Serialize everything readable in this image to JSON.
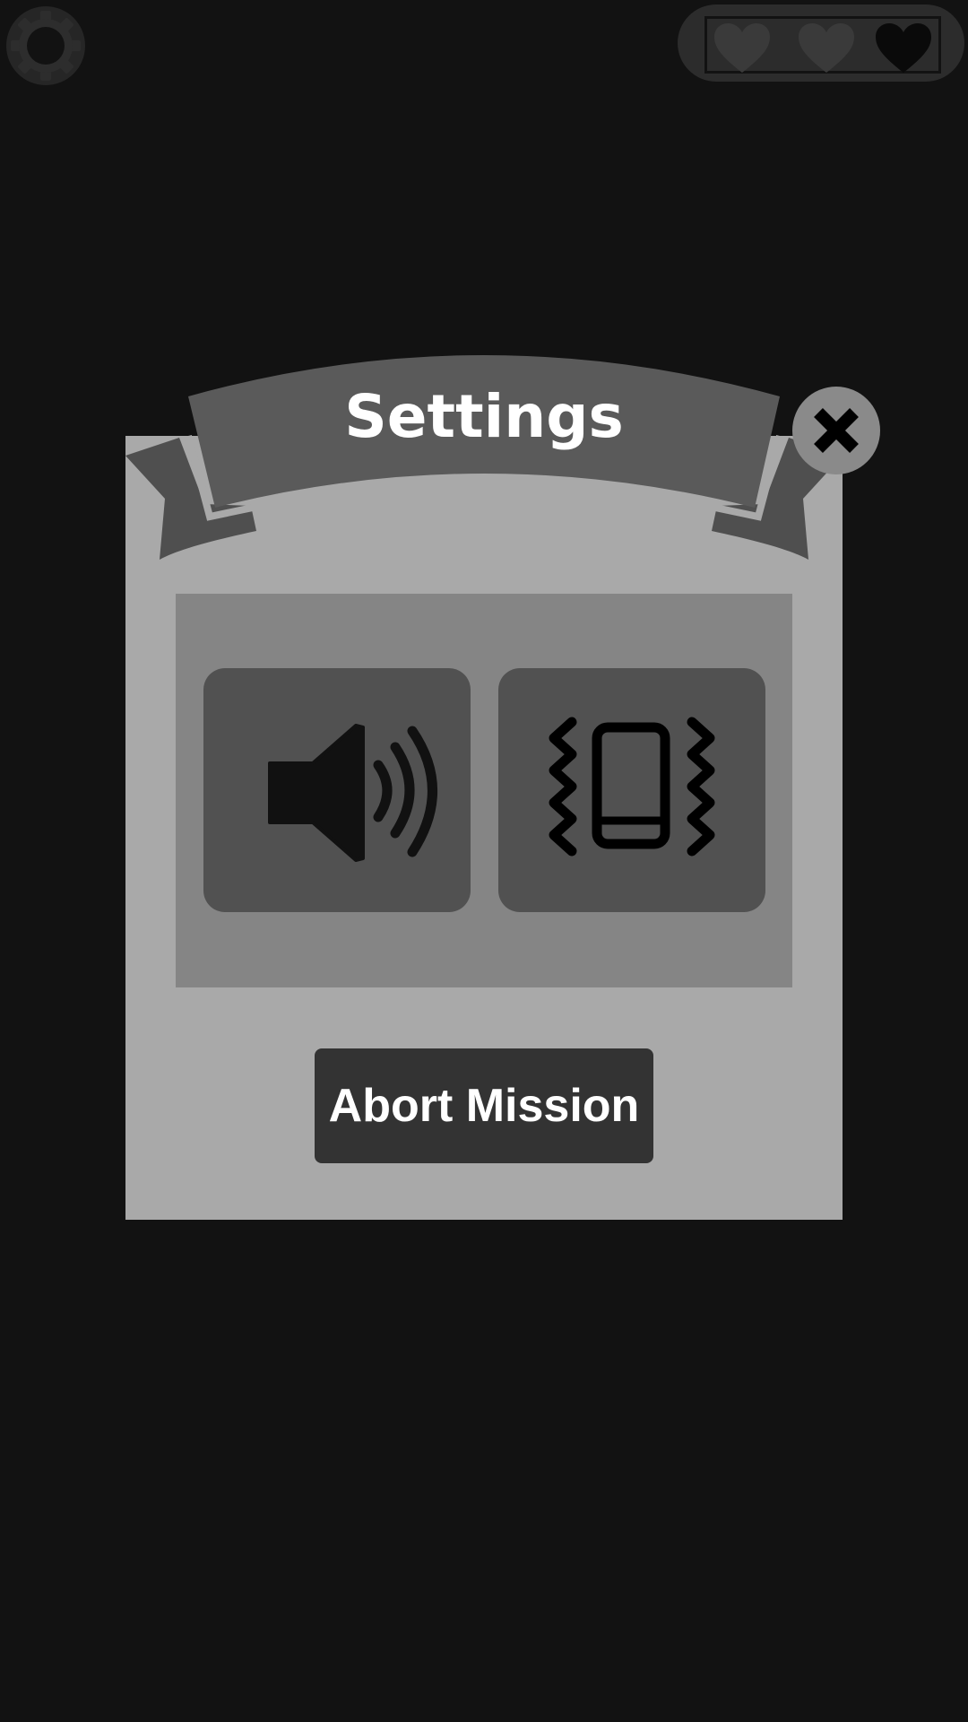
{
  "dialog": {
    "title": "Settings",
    "abort_label": "Abort Mission"
  },
  "hud": {
    "lives_total": 3,
    "lives_remaining": 2
  },
  "icons": {
    "gear": "gear-icon",
    "heart": "heart-icon",
    "close": "close-icon",
    "sound": "speaker-icon",
    "vibration": "phone-vibrate-icon"
  },
  "colors": {
    "background": "#121212",
    "panel": "#a9a9a9",
    "ribbon": "#5a5a5a",
    "ribbon_tail": "#4f4f4f",
    "options_box": "#858585",
    "tile": "#515151",
    "button": "#333333",
    "heart_full": "#3a3a3a",
    "heart_empty": "#0a0a0a",
    "text": "#ffffff"
  }
}
